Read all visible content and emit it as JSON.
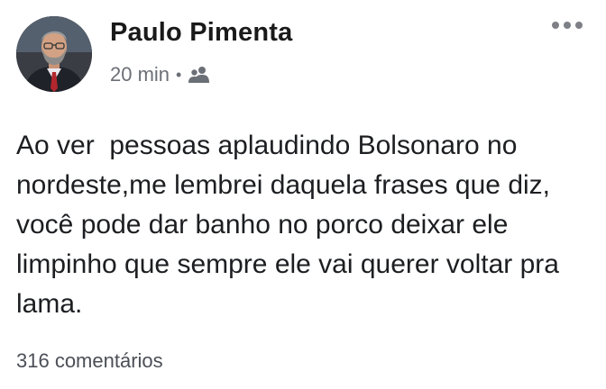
{
  "post": {
    "author": "Paulo Pimenta",
    "timestamp": "20 min",
    "separator": "•",
    "audience_icon": "friends-icon",
    "more_icon": "more-options-icon",
    "text": "Ao ver  pessoas aplaudindo Bolsonaro no nordeste,me lembrei daquela frases que diz, você pode dar banho no porco deixar ele limpinho que sempre ele vai querer voltar pra lama.",
    "comments_count": "316 comentários"
  },
  "colors": {
    "author_text": "#1a1a1a",
    "meta_text": "#6b6f76",
    "body_text": "#1c1e21"
  }
}
